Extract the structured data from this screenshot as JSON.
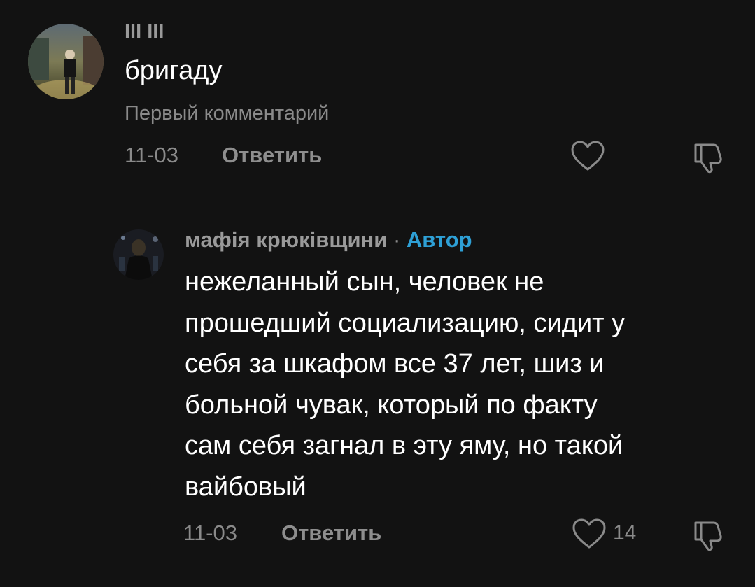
{
  "comments": [
    {
      "username": "III III",
      "text": "бригаду",
      "tag": "Первый комментарий",
      "date": "11-03",
      "reply_label": "Ответить",
      "like_count": "",
      "avatar_icon": "person-photo-avatar"
    }
  ],
  "replies": [
    {
      "username": "мафія крюківщини",
      "separator": "·",
      "author_badge": "Автор",
      "text_lines": [
        "нежеланный сын, человек не",
        "прошедший социализацию, сидит у",
        "себя за шкафом все 37 лет, шиз и",
        "больной чувак, который по факту",
        "сам себя загнал в эту яму, но такой",
        "вайбовый"
      ],
      "date": "11-03",
      "reply_label": "Ответить",
      "like_count": "14",
      "avatar_icon": "person-photo-avatar"
    }
  ],
  "icons": {
    "like": "heart-icon",
    "dislike": "thumbs-down-icon"
  },
  "colors": {
    "background": "#121212",
    "text": "#ffffff",
    "muted": "#8a8a8a",
    "author_badge": "#2ea0d6"
  }
}
